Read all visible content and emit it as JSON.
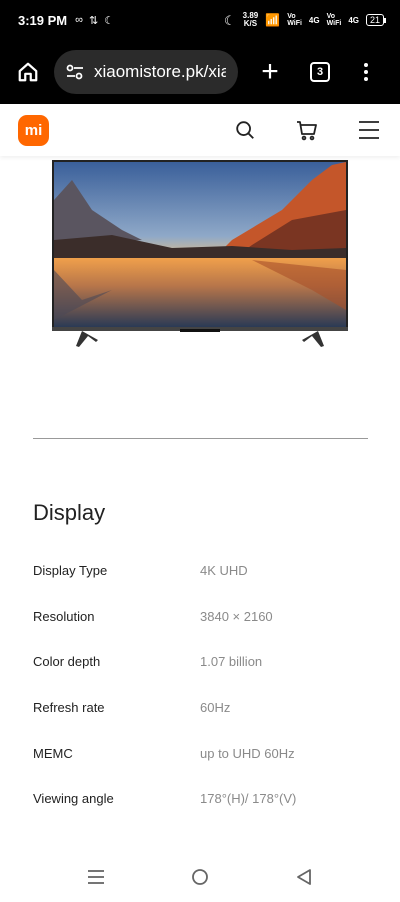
{
  "status_bar": {
    "time": "3:19 PM",
    "speed_value": "3.89",
    "speed_unit": "K/S",
    "sim1_label_top": "Vo",
    "sim1_label_bottom": "WiFi",
    "sim1_net": "4G",
    "sim2_label_top": "Vo",
    "sim2_label_bottom": "WiFi",
    "sim2_net": "4G",
    "battery": "21"
  },
  "browser": {
    "url": "xiaomistore.pk/xia",
    "tab_count": "3"
  },
  "site_header": {
    "logo_text": "mi",
    "brand_color": "#ff6700"
  },
  "section": {
    "title": "Display"
  },
  "specs": [
    {
      "label": "Display Type",
      "value": "4K UHD"
    },
    {
      "label": "Resolution",
      "value": "3840 × 2160"
    },
    {
      "label": "Color depth",
      "value": "1.07 billion"
    },
    {
      "label": "Refresh rate",
      "value": "60Hz"
    },
    {
      "label": "MEMC",
      "value": "up to UHD 60Hz"
    },
    {
      "label": "Viewing angle",
      "value": "178°(H)/ 178°(V)"
    }
  ]
}
